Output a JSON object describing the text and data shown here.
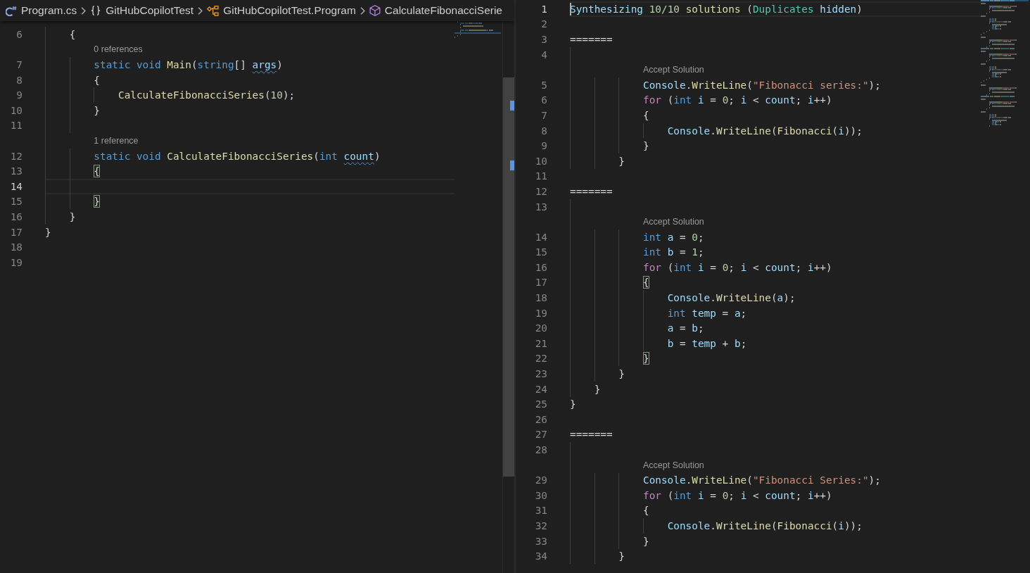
{
  "code_editor": {
    "focused": false,
    "breadcrumbs": [
      {
        "kind": "file",
        "label": "Program.cs"
      },
      {
        "kind": "namespace",
        "label": "GitHubCopilotTest"
      },
      {
        "kind": "class",
        "label": "GitHubCopilotTest.Program"
      },
      {
        "kind": "method",
        "label": "CalculateFibonacciSerie"
      }
    ],
    "lines": [
      {
        "kind": "code",
        "number": "6",
        "current": false,
        "tokens": [
          {
            "kind": "plain",
            "text": "    {"
          }
        ]
      },
      {
        "kind": "lens",
        "label": "0 references"
      },
      {
        "kind": "code",
        "number": "7",
        "current": false,
        "tokens": [
          {
            "kind": "keyword",
            "text": "        static void "
          },
          {
            "kind": "function",
            "text": "Main"
          },
          {
            "kind": "plain",
            "text": "("
          },
          {
            "kind": "keyword",
            "text": "string"
          },
          {
            "kind": "plain",
            "text": "[] "
          },
          {
            "kind": "warned",
            "text": "args"
          },
          {
            "kind": "plain",
            "text": ")"
          }
        ]
      },
      {
        "kind": "code",
        "number": "8",
        "current": false,
        "tokens": [
          {
            "kind": "plain",
            "text": "        {"
          }
        ]
      },
      {
        "kind": "code",
        "number": "9",
        "current": false,
        "tokens": [
          {
            "kind": "function",
            "text": "            CalculateFibonacciSeries"
          },
          {
            "kind": "plain",
            "text": "("
          },
          {
            "kind": "number",
            "text": "10"
          },
          {
            "kind": "plain",
            "text": ");"
          }
        ]
      },
      {
        "kind": "code",
        "number": "10",
        "current": false,
        "tokens": [
          {
            "kind": "plain",
            "text": "        }"
          }
        ]
      },
      {
        "kind": "code",
        "number": "11",
        "current": false
      },
      {
        "kind": "lens",
        "label": "1 reference"
      },
      {
        "kind": "code",
        "number": "12",
        "current": false,
        "tokens": [
          {
            "kind": "keyword",
            "text": "        static void "
          },
          {
            "kind": "function",
            "text": "CalculateFibonacciSeries"
          },
          {
            "kind": "plain",
            "text": "("
          },
          {
            "kind": "keyword",
            "text": "int "
          },
          {
            "kind": "warned",
            "text": "count"
          },
          {
            "kind": "plain",
            "text": ")"
          }
        ]
      },
      {
        "kind": "code",
        "number": "13",
        "current": false,
        "tokens": [
          {
            "kind": "bracket",
            "text": "        {"
          }
        ]
      },
      {
        "kind": "code",
        "number": "14",
        "current": true
      },
      {
        "kind": "code",
        "number": "15",
        "current": false,
        "tokens": [
          {
            "kind": "bracket",
            "text": "        }"
          }
        ]
      },
      {
        "kind": "code",
        "number": "16",
        "current": false,
        "tokens": [
          {
            "kind": "plain",
            "text": "    }"
          }
        ]
      },
      {
        "kind": "code",
        "number": "17",
        "current": false,
        "tokens": [
          {
            "kind": "plain",
            "text": "}"
          }
        ]
      },
      {
        "kind": "code",
        "number": "18",
        "current": false
      },
      {
        "kind": "code",
        "number": "19",
        "current": false
      }
    ]
  },
  "solutions_panel": {
    "focused": true,
    "lines": [
      {
        "kind": "code",
        "number": "1",
        "current": true,
        "tokens": [
          {
            "kind": "variable",
            "text": "Synthesizing "
          },
          {
            "kind": "number",
            "text": "10/10 "
          },
          {
            "kind": "function",
            "text": "solutions "
          },
          {
            "kind": "plain",
            "text": "("
          },
          {
            "kind": "type",
            "text": "Duplicates "
          },
          {
            "kind": "variable",
            "text": "hidden"
          },
          {
            "kind": "plain",
            "text": ")"
          }
        ]
      },
      {
        "kind": "code",
        "number": "2",
        "current": false
      },
      {
        "kind": "code",
        "number": "3",
        "current": false,
        "tokens": [
          {
            "kind": "plain",
            "text": "======="
          }
        ]
      },
      {
        "kind": "code",
        "number": "4",
        "current": false
      },
      {
        "kind": "lens",
        "label": "Accept Solution"
      },
      {
        "kind": "code",
        "number": "5",
        "current": false,
        "tokens": [
          {
            "kind": "variable",
            "text": "            Console"
          },
          {
            "kind": "plain",
            "text": "."
          },
          {
            "kind": "function",
            "text": "WriteLine"
          },
          {
            "kind": "plain",
            "text": "("
          },
          {
            "kind": "string",
            "text": "\"Fibonacci series:\""
          },
          {
            "kind": "plain",
            "text": ");"
          }
        ]
      },
      {
        "kind": "code",
        "number": "6",
        "current": false,
        "tokens": [
          {
            "kind": "control",
            "text": "            for "
          },
          {
            "kind": "plain",
            "text": "("
          },
          {
            "kind": "keyword",
            "text": "int "
          },
          {
            "kind": "variable",
            "text": "i"
          },
          {
            "kind": "plain",
            "text": " = "
          },
          {
            "kind": "number",
            "text": "0"
          },
          {
            "kind": "plain",
            "text": "; "
          },
          {
            "kind": "variable",
            "text": "i"
          },
          {
            "kind": "plain",
            "text": " < "
          },
          {
            "kind": "variable",
            "text": "count"
          },
          {
            "kind": "plain",
            "text": "; "
          },
          {
            "kind": "variable",
            "text": "i"
          },
          {
            "kind": "plain",
            "text": "++)"
          }
        ]
      },
      {
        "kind": "code",
        "number": "7",
        "current": false,
        "tokens": [
          {
            "kind": "plain",
            "text": "            {"
          }
        ]
      },
      {
        "kind": "code",
        "number": "8",
        "current": false,
        "tokens": [
          {
            "kind": "variable",
            "text": "                Console"
          },
          {
            "kind": "plain",
            "text": "."
          },
          {
            "kind": "function",
            "text": "WriteLine"
          },
          {
            "kind": "plain",
            "text": "("
          },
          {
            "kind": "function",
            "text": "Fibonacci"
          },
          {
            "kind": "plain",
            "text": "("
          },
          {
            "kind": "variable",
            "text": "i"
          },
          {
            "kind": "plain",
            "text": "));"
          }
        ]
      },
      {
        "kind": "code",
        "number": "9",
        "current": false,
        "tokens": [
          {
            "kind": "plain",
            "text": "            }"
          }
        ]
      },
      {
        "kind": "code",
        "number": "10",
        "current": false,
        "tokens": [
          {
            "kind": "plain",
            "text": "        }"
          }
        ]
      },
      {
        "kind": "code",
        "number": "11",
        "current": false
      },
      {
        "kind": "code",
        "number": "12",
        "current": false,
        "tokens": [
          {
            "kind": "plain",
            "text": "======="
          }
        ]
      },
      {
        "kind": "code",
        "number": "13",
        "current": false
      },
      {
        "kind": "lens",
        "label": "Accept Solution"
      },
      {
        "kind": "code",
        "number": "14",
        "current": false,
        "tokens": [
          {
            "kind": "keyword",
            "text": "            int "
          },
          {
            "kind": "variable",
            "text": "a"
          },
          {
            "kind": "plain",
            "text": " = "
          },
          {
            "kind": "number",
            "text": "0"
          },
          {
            "kind": "plain",
            "text": ";"
          }
        ]
      },
      {
        "kind": "code",
        "number": "15",
        "current": false,
        "tokens": [
          {
            "kind": "keyword",
            "text": "            int "
          },
          {
            "kind": "variable",
            "text": "b"
          },
          {
            "kind": "plain",
            "text": " = "
          },
          {
            "kind": "number",
            "text": "1"
          },
          {
            "kind": "plain",
            "text": ";"
          }
        ]
      },
      {
        "kind": "code",
        "number": "16",
        "current": false,
        "tokens": [
          {
            "kind": "control",
            "text": "            for "
          },
          {
            "kind": "plain",
            "text": "("
          },
          {
            "kind": "keyword",
            "text": "int "
          },
          {
            "kind": "variable",
            "text": "i"
          },
          {
            "kind": "plain",
            "text": " = "
          },
          {
            "kind": "number",
            "text": "0"
          },
          {
            "kind": "plain",
            "text": "; "
          },
          {
            "kind": "variable",
            "text": "i"
          },
          {
            "kind": "plain",
            "text": " < "
          },
          {
            "kind": "variable",
            "text": "count"
          },
          {
            "kind": "plain",
            "text": "; "
          },
          {
            "kind": "variable",
            "text": "i"
          },
          {
            "kind": "plain",
            "text": "++)"
          }
        ]
      },
      {
        "kind": "code",
        "number": "17",
        "current": false,
        "tokens": [
          {
            "kind": "bracket",
            "text": "            {"
          }
        ]
      },
      {
        "kind": "code",
        "number": "18",
        "current": false,
        "tokens": [
          {
            "kind": "variable",
            "text": "                Console"
          },
          {
            "kind": "plain",
            "text": "."
          },
          {
            "kind": "function",
            "text": "WriteLine"
          },
          {
            "kind": "plain",
            "text": "("
          },
          {
            "kind": "variable",
            "text": "a"
          },
          {
            "kind": "plain",
            "text": ");"
          }
        ]
      },
      {
        "kind": "code",
        "number": "19",
        "current": false,
        "tokens": [
          {
            "kind": "keyword",
            "text": "                int "
          },
          {
            "kind": "variable",
            "text": "temp"
          },
          {
            "kind": "plain",
            "text": " = "
          },
          {
            "kind": "variable",
            "text": "a"
          },
          {
            "kind": "plain",
            "text": ";"
          }
        ]
      },
      {
        "kind": "code",
        "number": "20",
        "current": false,
        "tokens": [
          {
            "kind": "variable",
            "text": "                a"
          },
          {
            "kind": "plain",
            "text": " = "
          },
          {
            "kind": "variable",
            "text": "b"
          },
          {
            "kind": "plain",
            "text": ";"
          }
        ]
      },
      {
        "kind": "code",
        "number": "21",
        "current": false,
        "tokens": [
          {
            "kind": "variable",
            "text": "                b"
          },
          {
            "kind": "plain",
            "text": " = "
          },
          {
            "kind": "variable",
            "text": "temp"
          },
          {
            "kind": "plain",
            "text": " + "
          },
          {
            "kind": "variable",
            "text": "b"
          },
          {
            "kind": "plain",
            "text": ";"
          }
        ]
      },
      {
        "kind": "code",
        "number": "22",
        "current": false,
        "tokens": [
          {
            "kind": "bracket",
            "text": "            }"
          }
        ]
      },
      {
        "kind": "code",
        "number": "23",
        "current": false,
        "tokens": [
          {
            "kind": "plain",
            "text": "        }"
          }
        ]
      },
      {
        "kind": "code",
        "number": "24",
        "current": false,
        "tokens": [
          {
            "kind": "plain",
            "text": "    }"
          }
        ]
      },
      {
        "kind": "code",
        "number": "25",
        "current": false,
        "tokens": [
          {
            "kind": "plain",
            "text": "}"
          }
        ]
      },
      {
        "kind": "code",
        "number": "26",
        "current": false
      },
      {
        "kind": "code",
        "number": "27",
        "current": false,
        "tokens": [
          {
            "kind": "plain",
            "text": "======="
          }
        ]
      },
      {
        "kind": "code",
        "number": "28",
        "current": false
      },
      {
        "kind": "lens",
        "label": "Accept Solution"
      },
      {
        "kind": "code",
        "number": "29",
        "current": false,
        "tokens": [
          {
            "kind": "variable",
            "text": "            Console"
          },
          {
            "kind": "plain",
            "text": "."
          },
          {
            "kind": "function",
            "text": "WriteLine"
          },
          {
            "kind": "plain",
            "text": "("
          },
          {
            "kind": "string",
            "text": "\"Fibonacci Series:\""
          },
          {
            "kind": "plain",
            "text": ");"
          }
        ]
      },
      {
        "kind": "code",
        "number": "30",
        "current": false,
        "tokens": [
          {
            "kind": "control",
            "text": "            for "
          },
          {
            "kind": "plain",
            "text": "("
          },
          {
            "kind": "keyword",
            "text": "int "
          },
          {
            "kind": "variable",
            "text": "i"
          },
          {
            "kind": "plain",
            "text": " = "
          },
          {
            "kind": "number",
            "text": "0"
          },
          {
            "kind": "plain",
            "text": "; "
          },
          {
            "kind": "variable",
            "text": "i"
          },
          {
            "kind": "plain",
            "text": " < "
          },
          {
            "kind": "variable",
            "text": "count"
          },
          {
            "kind": "plain",
            "text": "; "
          },
          {
            "kind": "variable",
            "text": "i"
          },
          {
            "kind": "plain",
            "text": "++)"
          }
        ]
      },
      {
        "kind": "code",
        "number": "31",
        "current": false,
        "tokens": [
          {
            "kind": "plain",
            "text": "            {"
          }
        ]
      },
      {
        "kind": "code",
        "number": "32",
        "current": false,
        "tokens": [
          {
            "kind": "variable",
            "text": "                Console"
          },
          {
            "kind": "plain",
            "text": "."
          },
          {
            "kind": "function",
            "text": "WriteLine"
          },
          {
            "kind": "plain",
            "text": "("
          },
          {
            "kind": "function",
            "text": "Fibonacci"
          },
          {
            "kind": "plain",
            "text": "("
          },
          {
            "kind": "variable",
            "text": "i"
          },
          {
            "kind": "plain",
            "text": "));"
          }
        ]
      },
      {
        "kind": "code",
        "number": "33",
        "current": false,
        "tokens": [
          {
            "kind": "plain",
            "text": "            }"
          }
        ]
      },
      {
        "kind": "code",
        "number": "34",
        "current": false,
        "tokens": [
          {
            "kind": "plain",
            "text": "        }"
          }
        ]
      }
    ]
  }
}
